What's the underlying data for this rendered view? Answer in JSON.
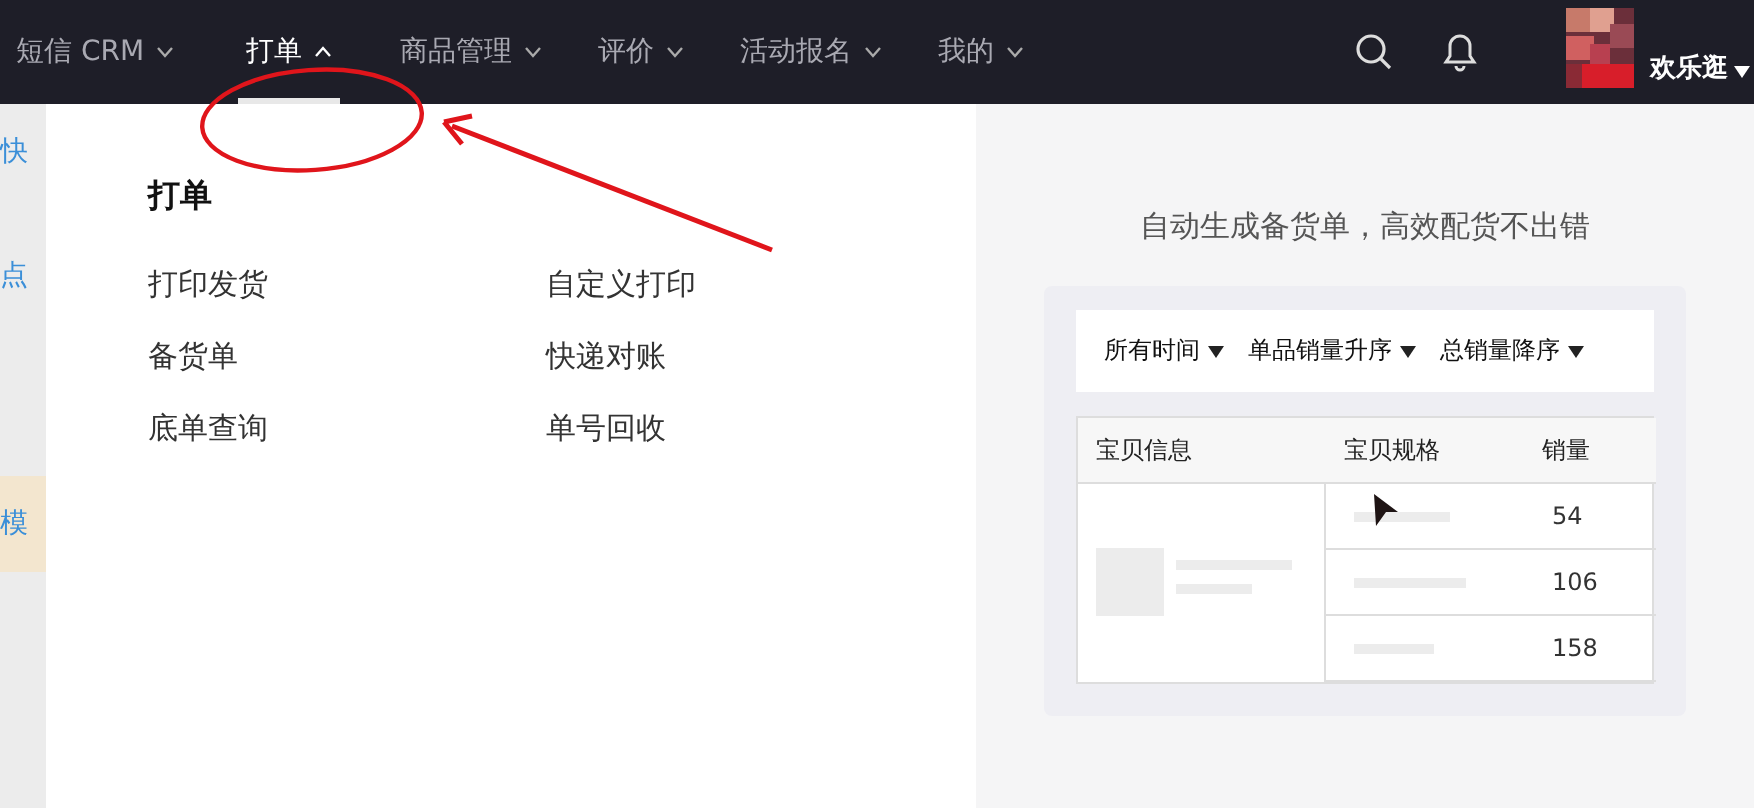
{
  "nav": {
    "items": [
      {
        "label": "短信 CRM",
        "selected": false
      },
      {
        "label": "打单",
        "selected": true
      },
      {
        "label": "商品管理",
        "selected": false
      },
      {
        "label": "评价",
        "selected": false
      },
      {
        "label": "活动报名",
        "selected": false
      },
      {
        "label": "我的",
        "selected": false
      }
    ]
  },
  "user": {
    "name": "欢乐逛"
  },
  "background_fragments": [
    "快",
    "点",
    "模"
  ],
  "dropdown": {
    "title": "打单",
    "items": [
      "打印发货",
      "自定义打印",
      "备货单",
      "快递对账",
      "底单查询",
      "单号回收"
    ]
  },
  "promo": {
    "caption": "自动生成备货单，高效配货不出错",
    "filters": [
      "所有时间",
      "单品销量升序",
      "总销量降序"
    ],
    "table": {
      "columns": [
        "宝贝信息",
        "宝贝规格",
        "销量"
      ],
      "rows": [
        {
          "sales": "54"
        },
        {
          "sales": "106"
        },
        {
          "sales": "158"
        }
      ]
    }
  }
}
